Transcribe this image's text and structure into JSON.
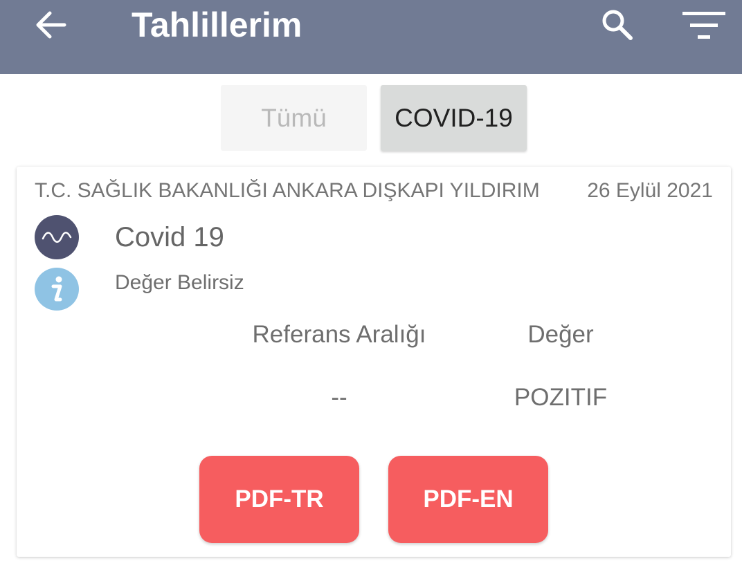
{
  "header": {
    "title": "Tahlillerim",
    "background_color": "#717b94",
    "icons": [
      "arrow-left-icon",
      "search-icon",
      "filter-icon"
    ]
  },
  "tabs": [
    {
      "label": "Tümü",
      "selected": false
    },
    {
      "label": "COVID-19",
      "selected": true
    }
  ],
  "result_card": {
    "institution": "T.C. SAĞLIK BAKANLIĞI ANKARA DIŞKAPI YILDIRIM",
    "date": "26 Eylül 2021",
    "test_name": "Covid 19",
    "status": "Değer Belirsiz",
    "columns": {
      "reference_range": "Referans Aralığı",
      "value": "Değer"
    },
    "reference_range_value": "--",
    "result_value": "POZITIF",
    "buttons": {
      "pdf_tr": "PDF-TR",
      "pdf_en": "PDF-EN"
    },
    "button_color": "#f65d5f"
  }
}
